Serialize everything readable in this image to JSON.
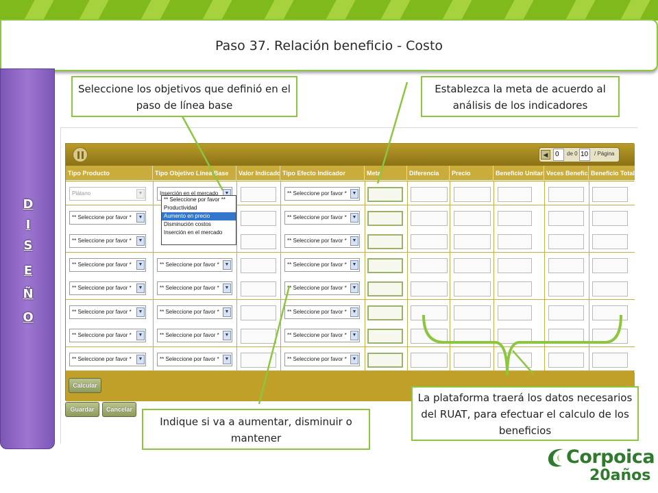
{
  "slide": {
    "title": "Paso 37. Relación beneficio - Costo",
    "side_letters": [
      "D",
      "I",
      "S",
      "E",
      "Ñ",
      "O"
    ]
  },
  "callouts": {
    "objetivos": "Seleccione los objetivos que definió en el paso de línea base",
    "meta": "Establezca la meta de acuerdo al análisis de los indicadores",
    "indique": "Indique si va a aumentar, disminuir o mantener",
    "plataforma": "La plataforma traerá los datos necesarios  del RUAT, para efectuar el calculo de los beneficios"
  },
  "grid": {
    "pager": {
      "current": "0",
      "of_label": "de 0",
      "page_size": "10",
      "page_label": "/ Página"
    },
    "columns": [
      "Tipo Producto",
      "Tipo Objetivo Línea Base",
      "Valor Indicador",
      "Tipo Efecto Indicador",
      "Meta",
      "Diferencia",
      "Precio",
      "Beneficio Unitario",
      "Veces Beneficio",
      "Beneficio Total"
    ],
    "rows": [
      {
        "producto": "Plátano",
        "objetivo": "Inserción en el mercado",
        "efecto": "** Seleccione por favor *"
      },
      {
        "producto": "** Seleccione por favor *",
        "objetivo": "",
        "efecto": "** Seleccione por favor *"
      },
      {
        "producto": "** Seleccione por favor *",
        "objetivo": "",
        "efecto": "** Seleccione por favor *"
      },
      {
        "producto": "** Seleccione por favor *",
        "objetivo": "** Seleccione por favor *",
        "efecto": "** Seleccione por favor *"
      },
      {
        "producto": "** Seleccione por favor *",
        "objetivo": "** Seleccione por favor *",
        "efecto": "** Seleccione por favor *"
      },
      {
        "producto": "** Seleccione por favor *",
        "objetivo": "** Seleccione por favor *",
        "efecto": "** Seleccione por favor *"
      },
      {
        "producto": "** Seleccione por favor *",
        "objetivo": "** Seleccione por favor *",
        "efecto": "** Seleccione por favor *"
      },
      {
        "producto": "** Seleccione por favor *",
        "objetivo": "** Seleccione por favor *",
        "efecto": "** Seleccione por favor *"
      }
    ],
    "dropdown_options": [
      "** Seleccione por favor **",
      "Productividad",
      "Aumento en precio",
      "Disminución costos",
      "Inserción en el mercado"
    ],
    "dropdown_highlighted": "Aumento en precio",
    "calc_label": "Calcular"
  },
  "actions": {
    "save_label": "Guardar",
    "cancel_label": "Cancelar"
  },
  "logo": {
    "name": "Corpoica",
    "years": "20años"
  },
  "colors": {
    "accent_green": "#8cc63f",
    "grid_gold": "#c1a02a",
    "side_purple": "#8a63c2",
    "logo_green": "#2f7a2c"
  },
  "icons": {
    "dropdown": "chevron-down-icon",
    "pager_prev": "chevron-left-icon",
    "collapse": "collapse-toggle-icon"
  }
}
